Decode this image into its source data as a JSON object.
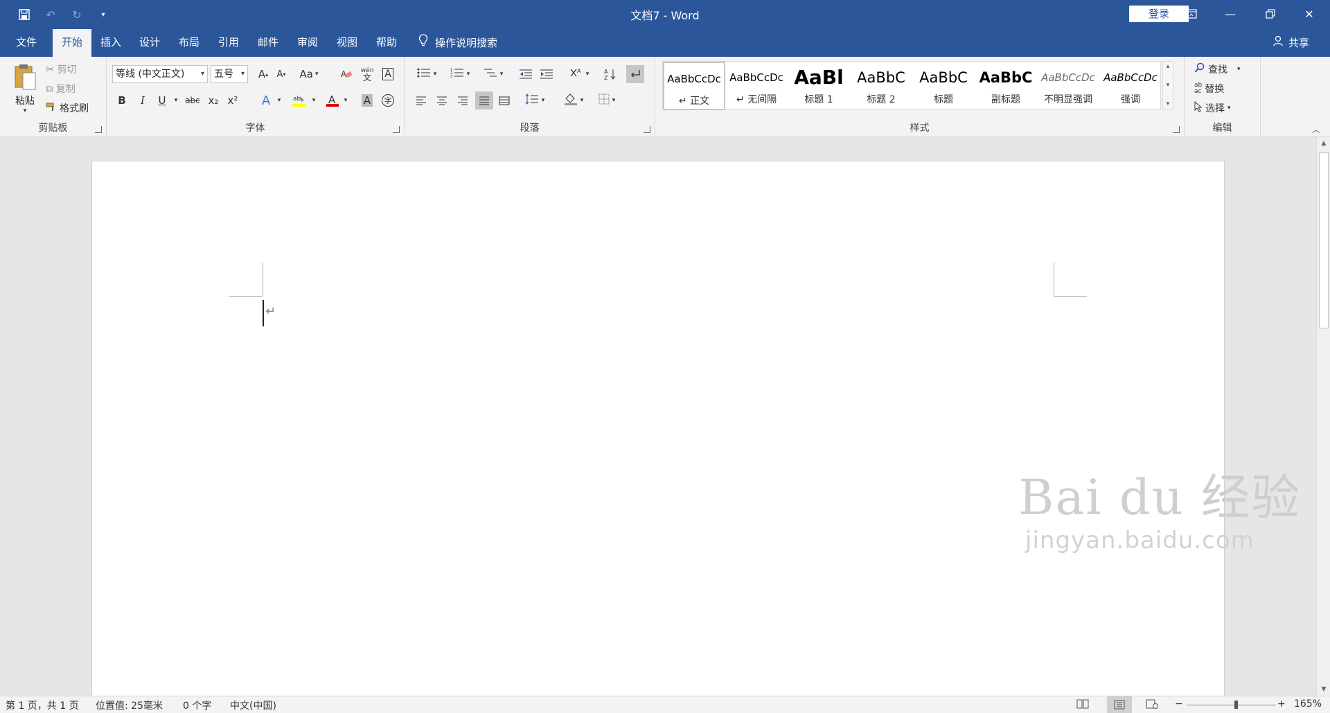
{
  "window": {
    "title": "文档7  -  Word",
    "login_label": "登录"
  },
  "qat": {
    "icons": [
      "save-icon",
      "undo-icon",
      "redo-icon",
      "customize-icon"
    ]
  },
  "tabs": [
    {
      "label": "文件"
    },
    {
      "label": "开始"
    },
    {
      "label": "插入"
    },
    {
      "label": "设计"
    },
    {
      "label": "布局"
    },
    {
      "label": "引用"
    },
    {
      "label": "邮件"
    },
    {
      "label": "审阅"
    },
    {
      "label": "视图"
    },
    {
      "label": "帮助"
    }
  ],
  "tell_me": "操作说明搜索",
  "share": "共享",
  "clipboard": {
    "group_label": "剪贴板",
    "paste": "粘贴",
    "cut": "剪切",
    "copy": "复制",
    "format_painter": "格式刷"
  },
  "font": {
    "group_label": "字体",
    "font_name": "等线 (中文正文)",
    "font_size": "五号",
    "change_case": "Aa",
    "bold": "B",
    "italic": "I",
    "underline": "U",
    "strikethrough": "abc",
    "subscript": "x₂",
    "superscript": "x²",
    "pinyin": "wén"
  },
  "paragraph": {
    "group_label": "段落"
  },
  "styles": {
    "group_label": "样式",
    "items": [
      {
        "preview": "AaBbCcDc",
        "name": "↵ 正文"
      },
      {
        "preview": "AaBbCcDc",
        "name": "↵ 无间隔"
      },
      {
        "preview": "AaBl",
        "name": "标题 1"
      },
      {
        "preview": "AaBbC",
        "name": "标题 2"
      },
      {
        "preview": "AaBbC",
        "name": "标题"
      },
      {
        "preview": "AaBbC",
        "name": "副标题"
      },
      {
        "preview": "AaBbCcDc",
        "name": "不明显强调"
      },
      {
        "preview": "AaBbCcDc",
        "name": "强调"
      }
    ]
  },
  "editing": {
    "group_label": "编辑",
    "find": "查找",
    "replace": "替换",
    "select": "选择"
  },
  "watermark": {
    "main": "Bai du 经验",
    "sub": "jingyan.baidu.com"
  },
  "status": {
    "page": "第 1 页，共 1 页",
    "position": "位置值: 25毫米",
    "words": "0 个字",
    "language": "中文(中国)",
    "zoom_minus": "−",
    "zoom_plus": "+",
    "zoom": "165%",
    "zoom_level": 0.55
  }
}
